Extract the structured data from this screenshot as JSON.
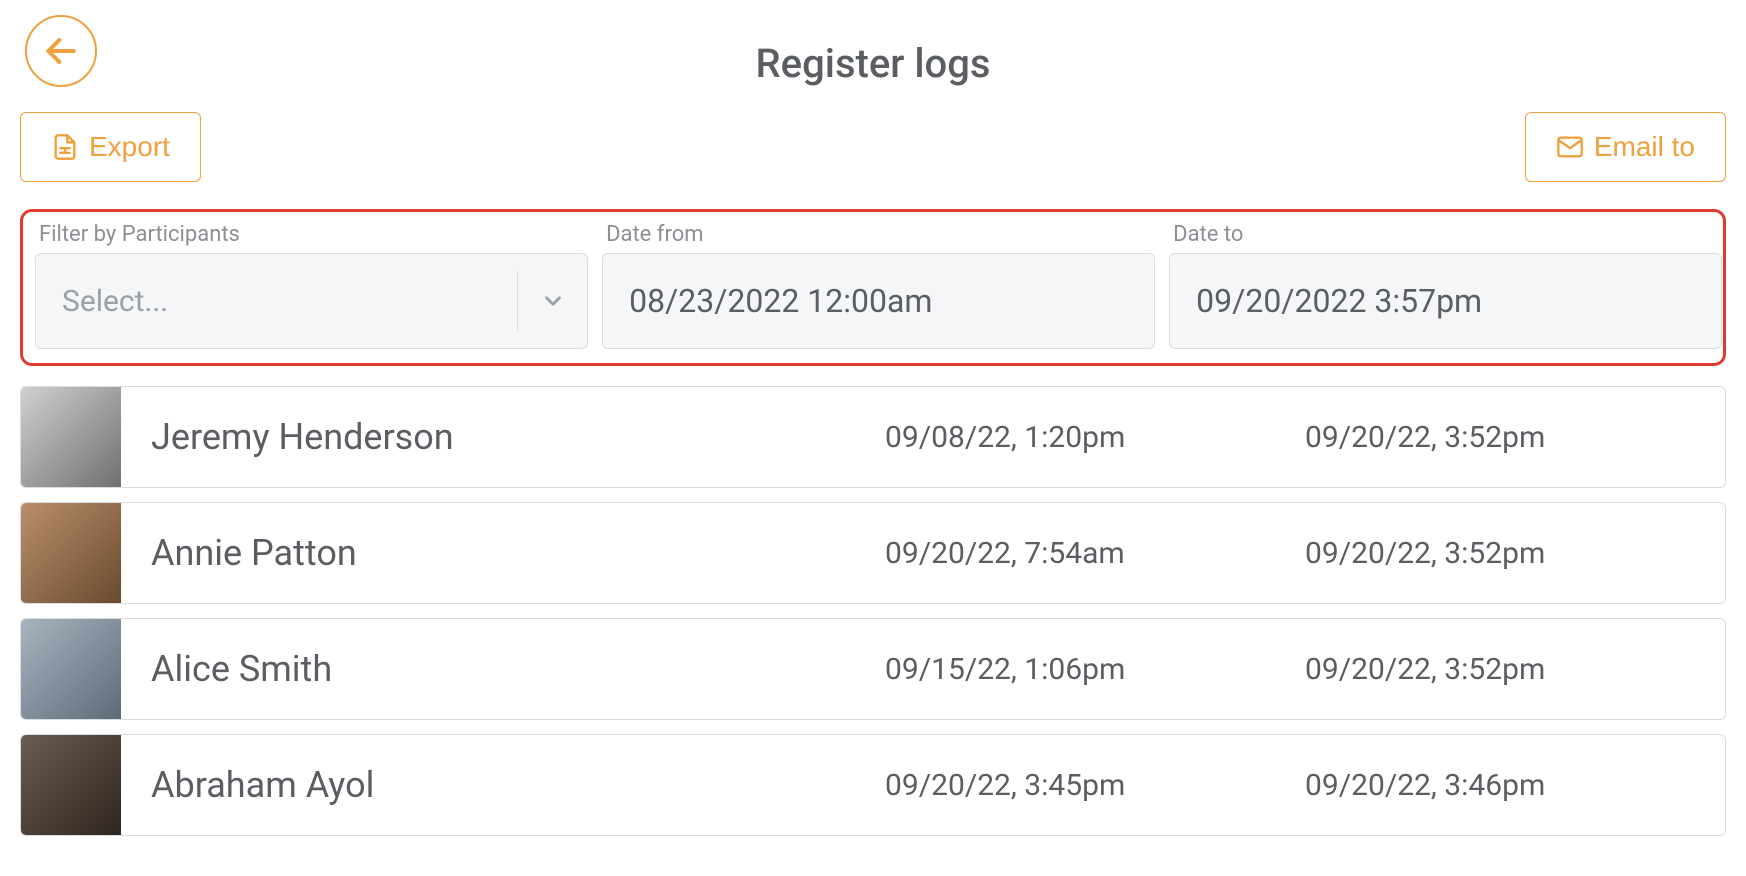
{
  "header": {
    "title": "Register logs"
  },
  "toolbar": {
    "export_label": "Export",
    "email_to_label": "Email to"
  },
  "filters": {
    "participants_label": "Filter by Participants",
    "participants_placeholder": "Select...",
    "date_from_label": "Date from",
    "date_from_value": "08/23/2022 12:00am",
    "date_to_label": "Date to",
    "date_to_value": "09/20/2022 3:57pm"
  },
  "rows": [
    {
      "name": "Jeremy Henderson",
      "date1": "09/08/22, 1:20pm",
      "date2": "09/20/22, 3:52pm"
    },
    {
      "name": "Annie Patton",
      "date1": "09/20/22, 7:54am",
      "date2": "09/20/22, 3:52pm"
    },
    {
      "name": "Alice Smith",
      "date1": "09/15/22, 1:06pm",
      "date2": "09/20/22, 3:52pm"
    },
    {
      "name": "Abraham Ayol",
      "date1": "09/20/22, 3:45pm",
      "date2": "09/20/22, 3:46pm"
    }
  ]
}
